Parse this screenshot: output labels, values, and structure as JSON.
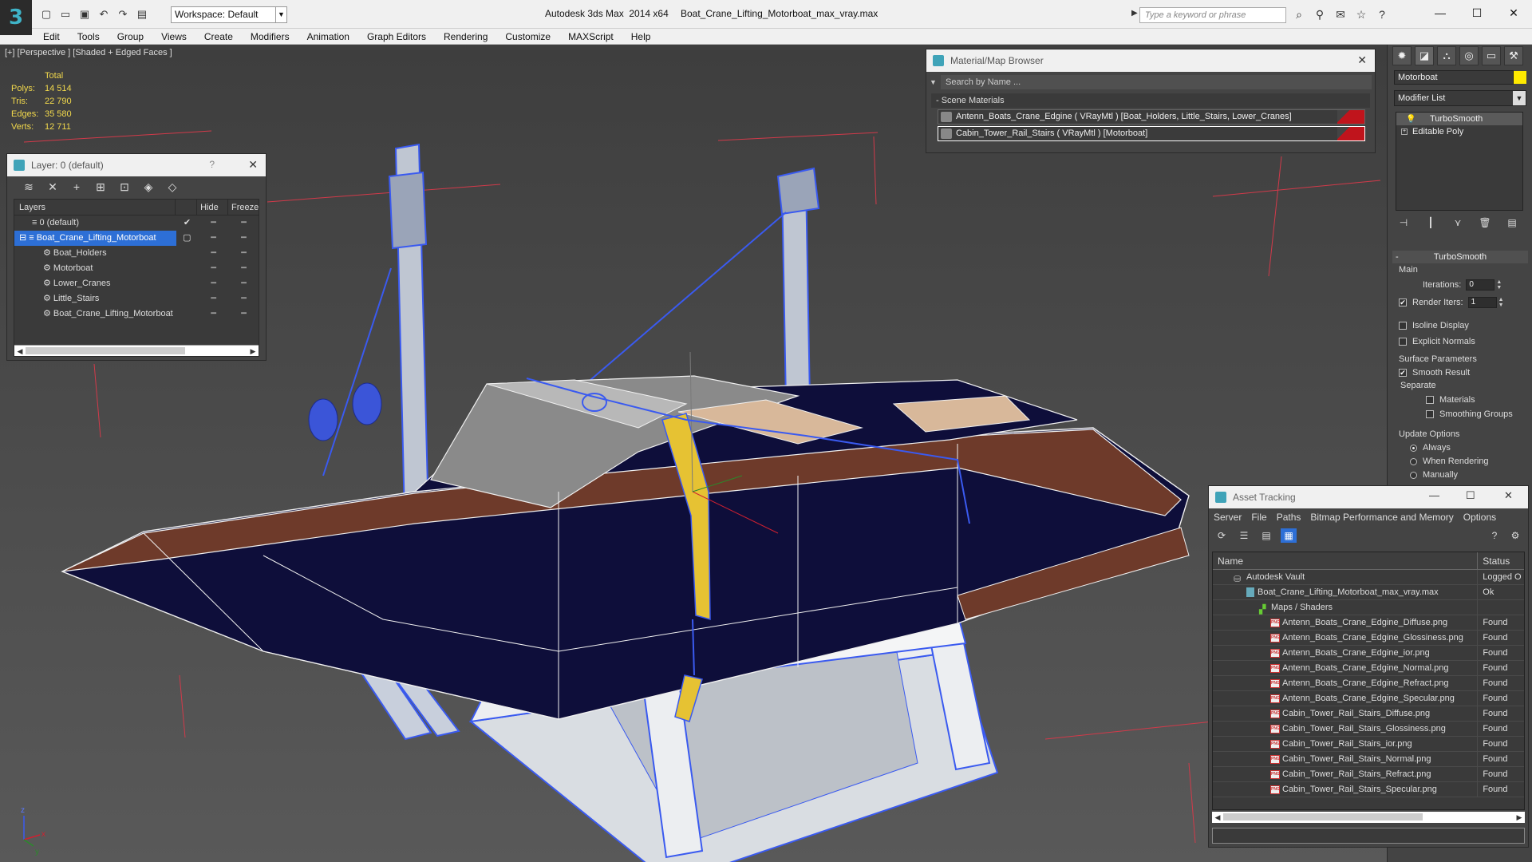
{
  "titlebar": {
    "app_title": "Autodesk 3ds Max  2014 x64",
    "file_name": "Boat_Crane_Lifting_Motorboat_max_vray.max",
    "workspace": "Workspace: Default",
    "search_placeholder": "Type a keyword or phrase"
  },
  "menu": [
    "Edit",
    "Tools",
    "Group",
    "Views",
    "Create",
    "Modifiers",
    "Animation",
    "Graph Editors",
    "Rendering",
    "Customize",
    "MAXScript",
    "Help"
  ],
  "viewport": {
    "label": "[+] [Perspective ] [Shaded + Edged Faces ]",
    "stats": {
      "header": "Total",
      "rows": [
        {
          "k": "Polys:",
          "v": "14 514"
        },
        {
          "k": "Tris:",
          "v": "22 790"
        },
        {
          "k": "Edges:",
          "v": "35 580"
        },
        {
          "k": "Verts:",
          "v": "12 711"
        }
      ]
    }
  },
  "layer_panel": {
    "title": "Layer: 0 (default)",
    "col_layers": "Layers",
    "col_hide": "Hide",
    "col_freeze": "Freeze",
    "rows": [
      {
        "name": "0 (default)",
        "indent": 0,
        "checked": true
      },
      {
        "name": "Boat_Crane_Lifting_Motorboat",
        "indent": 0,
        "selected": true
      },
      {
        "name": "Boat_Holders",
        "indent": 1
      },
      {
        "name": "Motorboat",
        "indent": 1
      },
      {
        "name": "Lower_Cranes",
        "indent": 1
      },
      {
        "name": "Little_Stairs",
        "indent": 1
      },
      {
        "name": "Boat_Crane_Lifting_Motorboat",
        "indent": 1
      }
    ]
  },
  "material_browser": {
    "title": "Material/Map Browser",
    "search": "Search by Name ...",
    "section": "- Scene Materials",
    "materials": [
      "Antenn_Boats_Crane_Edgine ( VRayMtl ) [Boat_Holders, Little_Stairs, Lower_Cranes]",
      "Cabin_Tower_Rail_Stairs ( VRayMtl ) [Motorboat]"
    ]
  },
  "command_panel": {
    "object_name": "Motorboat",
    "object_color": "#ffea00",
    "modifier_list": "Modifier List",
    "stack": [
      "TurboSmooth",
      "Editable Poly"
    ],
    "rollout_title": "TurboSmooth",
    "main_label": "Main",
    "iterations_label": "Iterations:",
    "iterations_value": "0",
    "render_iters_label": "Render Iters:",
    "render_iters_value": "1",
    "isoline": "Isoline Display",
    "explicit": "Explicit Normals",
    "surface_params": "Surface Parameters",
    "smooth_result": "Smooth Result",
    "separate": "Separate",
    "materials": "Materials",
    "smoothing_groups": "Smoothing Groups",
    "update_options": "Update Options",
    "always": "Always",
    "when_rendering": "When Rendering",
    "manually": "Manually"
  },
  "asset_tracking": {
    "title": "Asset Tracking",
    "menu": [
      "Server",
      "File",
      "Paths",
      "Bitmap Performance and Memory",
      "Options"
    ],
    "col_name": "Name",
    "col_status": "Status",
    "rows": [
      {
        "name": "Autodesk Vault",
        "status": "Logged O",
        "indent": 1,
        "icon": "vault"
      },
      {
        "name": "Boat_Crane_Lifting_Motorboat_max_vray.max",
        "status": "Ok",
        "indent": 2,
        "icon": "file"
      },
      {
        "name": "Maps / Shaders",
        "status": "",
        "indent": 3,
        "icon": "maps"
      },
      {
        "name": "Antenn_Boats_Crane_Edgine_Diffuse.png",
        "status": "Found",
        "indent": 4,
        "icon": "png"
      },
      {
        "name": "Antenn_Boats_Crane_Edgine_Glossiness.png",
        "status": "Found",
        "indent": 4,
        "icon": "png"
      },
      {
        "name": "Antenn_Boats_Crane_Edgine_ior.png",
        "status": "Found",
        "indent": 4,
        "icon": "png"
      },
      {
        "name": "Antenn_Boats_Crane_Edgine_Normal.png",
        "status": "Found",
        "indent": 4,
        "icon": "png"
      },
      {
        "name": "Antenn_Boats_Crane_Edgine_Refract.png",
        "status": "Found",
        "indent": 4,
        "icon": "png"
      },
      {
        "name": "Antenn_Boats_Crane_Edgine_Specular.png",
        "status": "Found",
        "indent": 4,
        "icon": "png"
      },
      {
        "name": "Cabin_Tower_Rail_Stairs_Diffuse.png",
        "status": "Found",
        "indent": 4,
        "icon": "png"
      },
      {
        "name": "Cabin_Tower_Rail_Stairs_Glossiness.png",
        "status": "Found",
        "indent": 4,
        "icon": "png"
      },
      {
        "name": "Cabin_Tower_Rail_Stairs_ior.png",
        "status": "Found",
        "indent": 4,
        "icon": "png"
      },
      {
        "name": "Cabin_Tower_Rail_Stairs_Normal.png",
        "status": "Found",
        "indent": 4,
        "icon": "png"
      },
      {
        "name": "Cabin_Tower_Rail_Stairs_Refract.png",
        "status": "Found",
        "indent": 4,
        "icon": "png"
      },
      {
        "name": "Cabin_Tower_Rail_Stairs_Specular.png",
        "status": "Found",
        "indent": 4,
        "icon": "png"
      }
    ]
  },
  "axis": {
    "x": "x",
    "y": "y",
    "z": "z"
  }
}
